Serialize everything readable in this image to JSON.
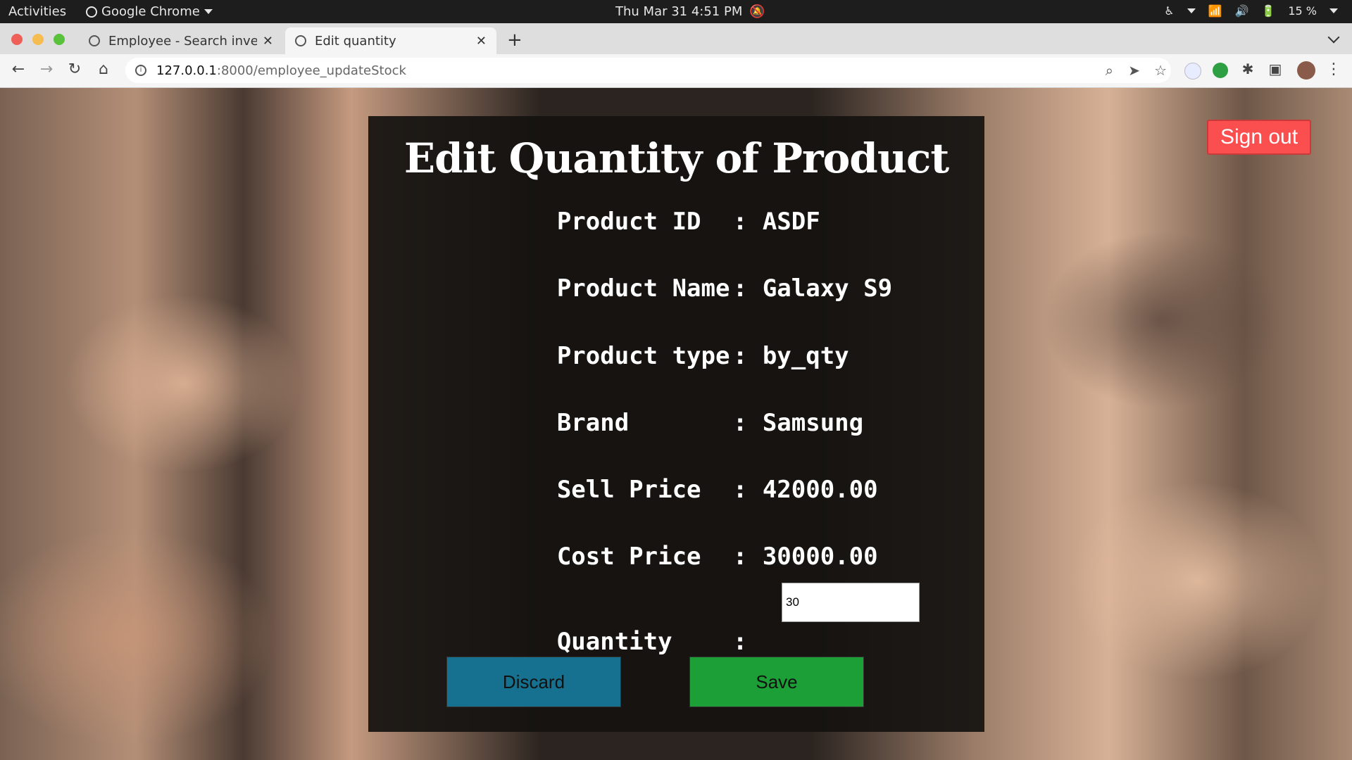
{
  "topbar": {
    "activities": "Activities",
    "app_name": "Google Chrome",
    "clock": "Thu Mar 31  4:51 PM",
    "battery": "15 %"
  },
  "tabs": [
    {
      "title": "Employee - Search invento",
      "active": false
    },
    {
      "title": "Edit quantity",
      "active": true
    }
  ],
  "toolbar": {
    "url_host": "127.0.0.1",
    "url_path": ":8000/employee_updateStock"
  },
  "page": {
    "title": "Edit Quantity of Product",
    "separator": ":",
    "fields": [
      {
        "label": "Product ID",
        "value": "ASDF"
      },
      {
        "label": "Product Name",
        "value": "Galaxy S9"
      },
      {
        "label": "Product type",
        "value": "by_qty"
      },
      {
        "label": "Brand",
        "value": "Samsung"
      },
      {
        "label": "Sell Price",
        "value": "42000.00"
      },
      {
        "label": "Cost Price",
        "value": "30000.00"
      }
    ],
    "quantity": {
      "label": "Quantity",
      "value": "30"
    },
    "discard_label": "Discard",
    "save_label": "Save",
    "signout_label": "Sign out"
  },
  "colors": {
    "discard": "#16708f",
    "save": "#1c9f36",
    "signout": "#fb4f4f"
  }
}
